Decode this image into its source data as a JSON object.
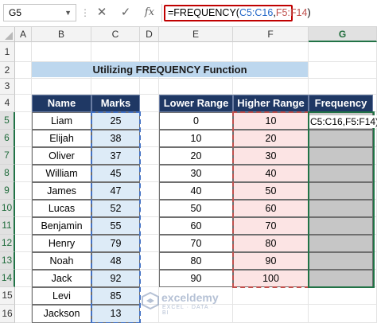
{
  "formula_bar": {
    "name_box": "G5",
    "cancel_icon": "close-icon",
    "enter_icon": "check-icon",
    "fx_label": "fx",
    "formula_prefix": "=FREQUENCY(",
    "formula_ref1": "C5:C16",
    "formula_sep": ",",
    "formula_ref2": "F5:F14",
    "formula_suffix": ")"
  },
  "column_headers": [
    "A",
    "B",
    "C",
    "D",
    "E",
    "F",
    "G"
  ],
  "row_headers": [
    "1",
    "2",
    "3",
    "4",
    "5",
    "6",
    "7",
    "8",
    "9",
    "10",
    "11",
    "12",
    "13",
    "14",
    "15",
    "16"
  ],
  "title": "Utilizing FREQUENCY Function",
  "marks_table": {
    "headers": [
      "Name",
      "Marks"
    ],
    "rows": [
      [
        "Liam",
        "25"
      ],
      [
        "Elijah",
        "38"
      ],
      [
        "Oliver",
        "37"
      ],
      [
        "William",
        "45"
      ],
      [
        "James",
        "47"
      ],
      [
        "Lucas",
        "52"
      ],
      [
        "Benjamin",
        "55"
      ],
      [
        "Henry",
        "79"
      ],
      [
        "Noah",
        "48"
      ],
      [
        "Jack",
        "92"
      ],
      [
        "Levi",
        "85"
      ],
      [
        "Jackson",
        "13"
      ]
    ]
  },
  "range_table": {
    "headers": [
      "Lower Range",
      "Higher Range",
      "Frequency"
    ],
    "rows": [
      [
        "0",
        "10"
      ],
      [
        "10",
        "20"
      ],
      [
        "20",
        "30"
      ],
      [
        "30",
        "40"
      ],
      [
        "40",
        "50"
      ],
      [
        "50",
        "60"
      ],
      [
        "60",
        "70"
      ],
      [
        "70",
        "80"
      ],
      [
        "80",
        "90"
      ],
      [
        "90",
        "100"
      ]
    ],
    "active_cell_text": "C5:C16,F5:F14)"
  },
  "watermark": {
    "name": "exceldemy",
    "sub": "EXCEL · DATA · BI"
  },
  "colors": {
    "title_fill": "#bdd7ee",
    "header_fill": "#1f3864",
    "marks_fill": "#ddebf7",
    "higher_fill": "#fce4e4",
    "frequency_fill": "#c6c6c6",
    "selection": "#217346",
    "formula_outline": "#c00000"
  }
}
